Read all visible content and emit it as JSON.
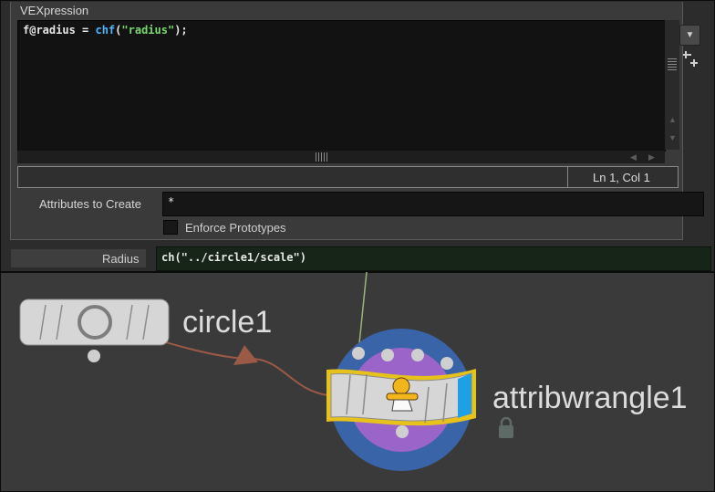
{
  "params": {
    "vex_title": "VEXpression",
    "code": {
      "var": "f@radius",
      "op": " = ",
      "fn": "chf",
      "open": "(",
      "str": "\"radius\"",
      "close": ");"
    },
    "cursor_position": "Ln 1, Col 1",
    "attributes_to_create": {
      "label": "Attributes to Create",
      "value": "*"
    },
    "enforce_prototypes": {
      "label": "Enforce Prototypes",
      "checked": false
    },
    "radius": {
      "label": "Radius",
      "expression": "ch(\"../circle1/scale\")"
    },
    "menu_icon": "triangle-down-icon",
    "add_param_icon": "add-parameter-icon"
  },
  "network": {
    "nodes": [
      {
        "name": "circle1",
        "type_icon": "circle-shape-icon",
        "selected": false
      },
      {
        "name": "attribwrangle1",
        "type_icon": "wrangler-cowboy-icon",
        "selected": true,
        "locked": true
      }
    ],
    "colors": {
      "selection": "#e7c21b",
      "display_flag": "#1fa0e6",
      "ring_outer": "#3a64a8",
      "ring_inner": "#9b64c9",
      "wire": "#9b5a46",
      "wire_in": "#9ab57a"
    }
  }
}
